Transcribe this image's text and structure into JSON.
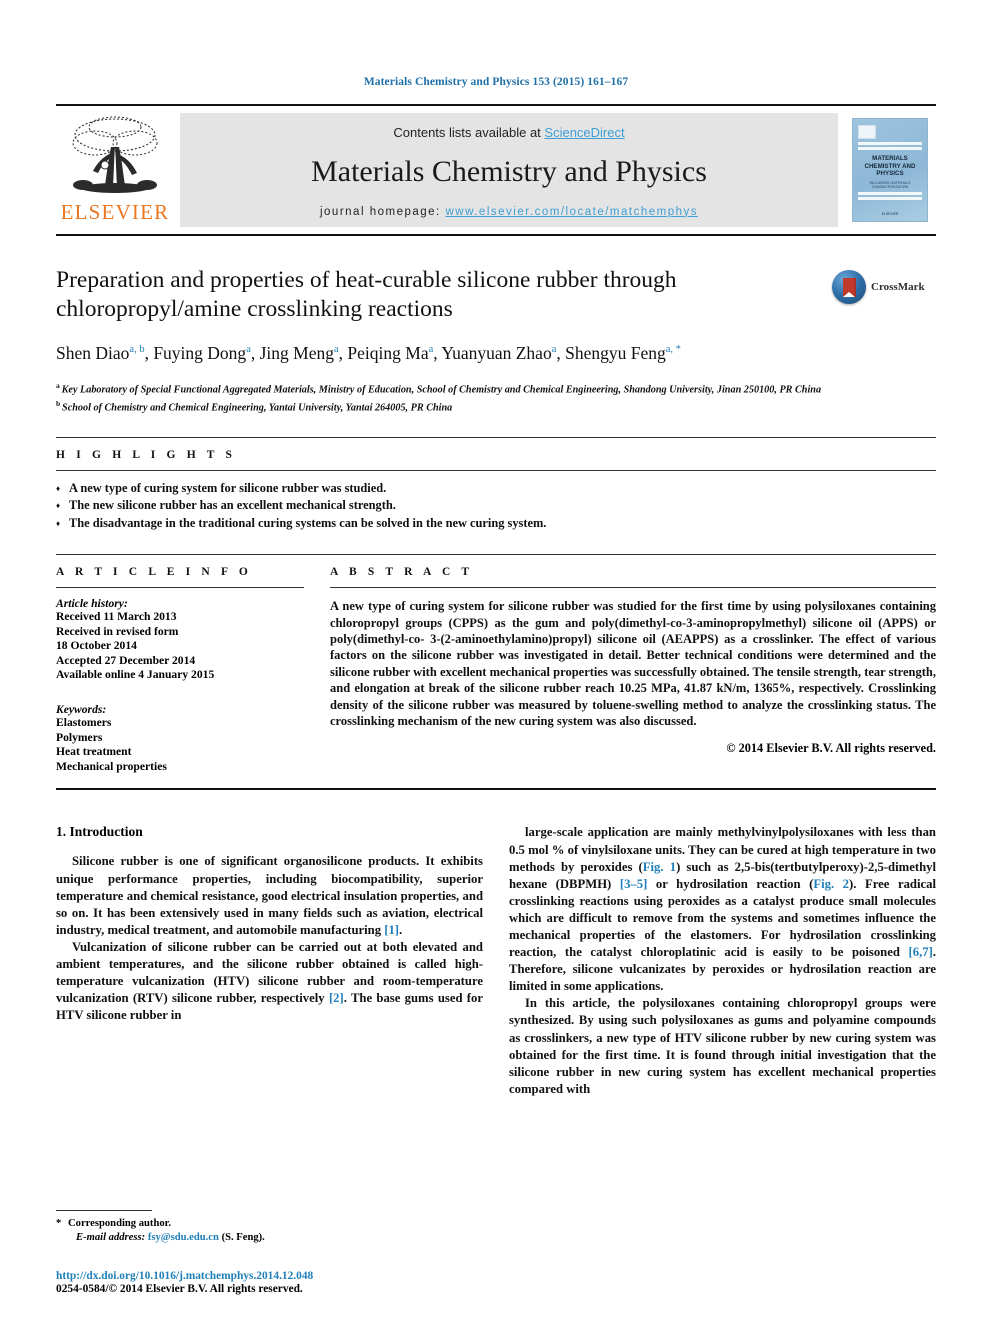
{
  "running_head": "Materials Chemistry and Physics 153 (2015) 161–167",
  "banner": {
    "contents_prefix": "Contents lists available at ",
    "sciencedirect": "ScienceDirect",
    "journal_title": "Materials Chemistry and Physics",
    "homepage_prefix": "journal homepage: ",
    "homepage_url": "www.elsevier.com/locate/matchemphys",
    "publisher": "ELSEVIER",
    "cover": {
      "title": "MATERIALS CHEMISTRY AND PHYSICS",
      "subtitle": "INCLUDING MATERIALS CHARACTERIZATION",
      "footer": "ELSEVIER"
    }
  },
  "article": {
    "title": "Preparation and properties of heat-curable silicone rubber through chloropropyl/amine crosslinking reactions",
    "crossmark_label": "CrossMark",
    "authors": [
      {
        "name": "Shen Diao",
        "marks": "a, b",
        "star": false
      },
      {
        "name": "Fuying Dong",
        "marks": "a",
        "star": false
      },
      {
        "name": "Jing Meng",
        "marks": "a",
        "star": false
      },
      {
        "name": "Peiqing Ma",
        "marks": "a",
        "star": false
      },
      {
        "name": "Yuanyuan Zhao",
        "marks": "a",
        "star": false
      },
      {
        "name": "Shengyu Feng",
        "marks": "a",
        "star": true
      }
    ],
    "affiliations": [
      {
        "mark": "a",
        "text": "Key Laboratory of Special Functional Aggregated Materials, Ministry of Education, School of Chemistry and Chemical Engineering, Shandong University, Jinan 250100, PR China"
      },
      {
        "mark": "b",
        "text": "School of Chemistry and Chemical Engineering, Yantai University, Yantai 264005, PR China"
      }
    ]
  },
  "highlights": {
    "heading": "H I G H L I G H T S",
    "items": [
      "A new type of curing system for silicone rubber was studied.",
      "The new silicone rubber has an excellent mechanical strength.",
      "The disadvantage in the traditional curing systems can be solved in the new curing system."
    ]
  },
  "article_info": {
    "heading": "A R T I C L E  I N F O",
    "history_label": "Article history:",
    "history": [
      "Received 11 March 2013",
      "Received in revised form",
      "18 October 2014",
      "Accepted 27 December 2014",
      "Available online 4 January 2015"
    ],
    "keywords_label": "Keywords:",
    "keywords": [
      "Elastomers",
      "Polymers",
      "Heat treatment",
      "Mechanical properties"
    ]
  },
  "abstract": {
    "heading": "A B S T R A C T",
    "text": "A new type of curing system for silicone rubber was studied for the first time by using polysiloxanes containing chloropropyl groups (CPPS) as the gum and poly(dimethyl-co-3-aminopropylmethyl) silicone oil (APPS) or poly(dimethyl-co- 3-(2-aminoethylamino)propyl) silicone oil (AEAPPS) as a crosslinker. The effect of various factors on the silicone rubber was investigated in detail. Better technical conditions were determined and the silicone rubber with excellent mechanical properties was successfully obtained. The tensile strength, tear strength, and elongation at break of the silicone rubber reach 10.25 MPa, 41.87 kN/m, 1365%, respectively. Crosslinking density of the silicone rubber was measured by toluene-swelling method to analyze the crosslinking status. The crosslinking mechanism of the new curing system was also discussed.",
    "copyright": "© 2014 Elsevier B.V. All rights reserved."
  },
  "introduction": {
    "section_number_title": "1.  Introduction",
    "left_paragraphs": [
      "Silicone rubber is one of significant organosilicone products. It exhibits unique performance properties, including biocompatibility, superior temperature and chemical resistance, good electrical insulation properties, and so on. It has been extensively used in many fields such as aviation, electrical industry, medical treatment, and automobile manufacturing [1].",
      "Vulcanization of silicone rubber can be carried out at both elevated and ambient temperatures, and the silicone rubber obtained is called high-temperature vulcanization (HTV) silicone rubber and room-temperature vulcanization (RTV) silicone rubber, respectively [2]. The base gums used for HTV silicone rubber in"
    ],
    "right_paragraphs": [
      "large-scale application are mainly methylvinylpolysiloxanes with less than 0.5 mol % of vinylsiloxane units. They can be cured at high temperature in two methods by peroxides (Fig. 1) such as 2,5-bis(tertbutylperoxy)-2,5-dimethyl hexane (DBPMH) [3–5] or hydrosilation reaction (Fig. 2). Free radical crosslinking reactions using peroxides as a catalyst produce small molecules which are difficult to remove from the systems and sometimes influence the mechanical properties of the elastomers. For hydrosilation crosslinking reaction, the catalyst chloroplatinic acid is easily to be poisoned [6,7]. Therefore, silicone vulcanizates by peroxides or hydrosilation reaction are limited in some applications.",
      "In this article, the polysiloxanes containing chloropropyl groups were synthesized. By using such polysiloxanes as gums and polyamine compounds as crosslinkers, a new type of HTV silicone rubber by new curing system was obtained for the first time. It is found through initial investigation that the silicone rubber in new curing system has excellent mechanical properties compared with"
    ],
    "reference_links": [
      "[1]",
      "[2]",
      "Fig. 1",
      "[3–5]",
      "Fig. 2",
      "[6,7]"
    ]
  },
  "footnote": {
    "corresponding_author": "Corresponding author.",
    "email_label": "E-mail address:",
    "email": "fsy@sdu.edu.cn",
    "email_owner": "(S. Feng)."
  },
  "footer": {
    "doi": "http://dx.doi.org/10.1016/j.matchemphys.2014.12.048",
    "issn_line": "0254-0584/© 2014 Elsevier B.V. All rights reserved."
  },
  "colors": {
    "link_blue": "#1f7fb8",
    "light_blue": "#3d9fd4",
    "elsevier_orange": "#e87722",
    "banner_grey": "#e4e4e4"
  }
}
